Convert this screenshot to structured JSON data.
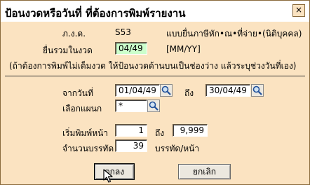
{
  "window": {
    "title": "ป้อนงวดหรือวันที่ ที่ต้องการพิมพ์รายงาน",
    "close_glyph": "×"
  },
  "form_type": {
    "label": "ภ.ง.ด.",
    "code": "S53",
    "description": "แบบยื่นภาษีหัก•ณ•ที่จ่าย•(นิติบุคคล)"
  },
  "period": {
    "label": "ยื่นรวมในงวด",
    "value": "04/49",
    "format_hint": "[MM/YY]"
  },
  "note": "(ถ้าต้องการพิมพ์ไม่เต็มงวด ให้ป้อนงวดด้านบนเป็นช่องว่าง แล้วระบุช่วงวันที่เอง)",
  "date_range": {
    "from_label": "จากวันที่",
    "from_value": "01/04/49",
    "to_label": "ถึง",
    "to_value": "30/04/49"
  },
  "department": {
    "label": "เลือกแผนก",
    "value": "*"
  },
  "page_range": {
    "label": "เริ่มพิมพ์หน้า",
    "from_value": "1",
    "to_label": "ถึง",
    "to_value": "9,999"
  },
  "lines": {
    "label": "จำนวนบรรทัด",
    "value": "39",
    "unit": "บรรทัด/หน้า"
  },
  "buttons": {
    "ok": "ตกลง",
    "cancel": "ยกเลิก"
  },
  "colors": {
    "dialog_bg": "#fbe3c1",
    "highlight_field": "#ccffcc"
  }
}
